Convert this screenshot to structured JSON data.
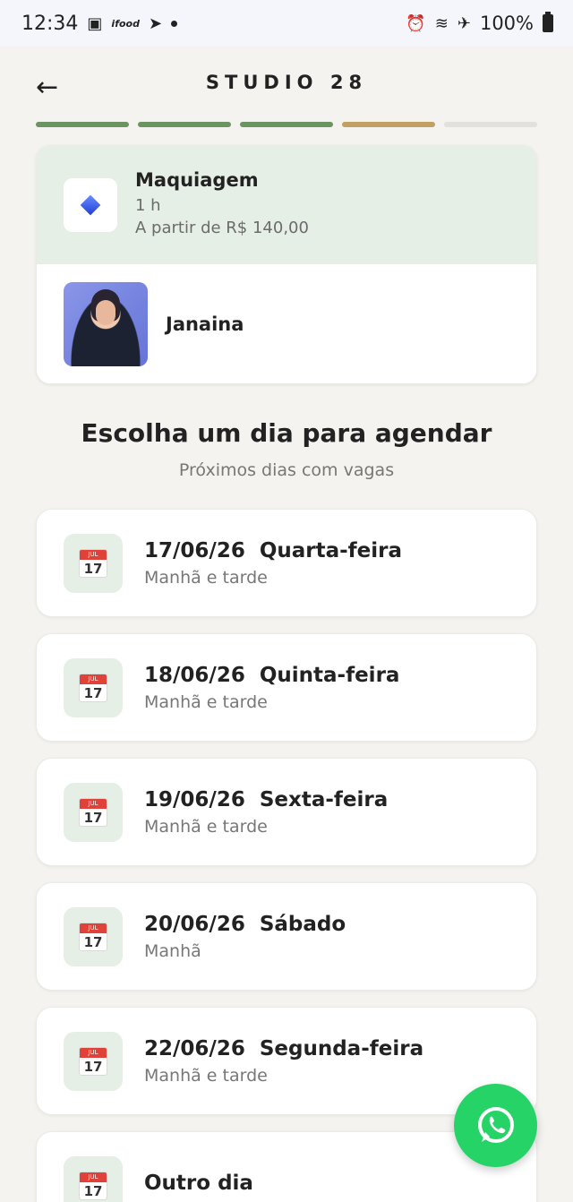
{
  "status_bar": {
    "time": "12:34",
    "ifood": "ifood",
    "battery": "100%"
  },
  "header": {
    "back_icon": "←",
    "title": "STUDIO 28"
  },
  "progress": {
    "total_steps": 5,
    "segment_colors": [
      "#6b9461",
      "#6b9461",
      "#6b9461",
      "#c1a063",
      "#e2e2dd"
    ]
  },
  "service": {
    "icon": "diamond-icon",
    "name": "Maquiagem",
    "duration": "1 h",
    "price": "A partir de R$ 140,00"
  },
  "professional": {
    "name": "Janaina"
  },
  "schedule": {
    "title": "Escolha um dia para agendar",
    "subtitle": "Próximos dias com vagas",
    "calendar_month": "JUL",
    "calendar_day": "17",
    "days": [
      {
        "date": "17/06/26",
        "weekday": "Quarta-feira",
        "periods": "Manhã e tarde"
      },
      {
        "date": "18/06/26",
        "weekday": "Quinta-feira",
        "periods": "Manhã e tarde"
      },
      {
        "date": "19/06/26",
        "weekday": "Sexta-feira",
        "periods": "Manhã e tarde"
      },
      {
        "date": "20/06/26",
        "weekday": "Sábado",
        "periods": "Manhã"
      },
      {
        "date": "22/06/26",
        "weekday": "Segunda-feira",
        "periods": "Manhã e tarde"
      }
    ],
    "other_day": "Outro dia"
  },
  "whatsapp": {
    "icon": "whatsapp-icon"
  },
  "colors": {
    "accent_green": "#6b9461",
    "accent_gold": "#c1a063",
    "light_green_bg": "#e6efe6",
    "whatsapp_green": "#25d366"
  }
}
